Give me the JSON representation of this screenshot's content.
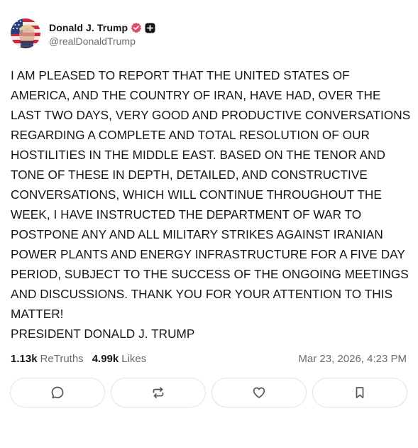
{
  "author": {
    "display_name": "Donald J. Trump",
    "handle": "@realDonaldTrump",
    "avatar_icon": "avatar-flag-portrait",
    "verified_color": "#e24b6a"
  },
  "post": {
    "text": "I AM PLEASED TO REPORT THAT THE UNITED STATES OF AMERICA, AND THE COUNTRY OF IRAN, HAVE HAD, OVER THE LAST TWO DAYS, VERY GOOD AND PRODUCTIVE CONVERSATIONS REGARDING A COMPLETE AND TOTAL RESOLUTION OF OUR HOSTILITIES IN THE MIDDLE EAST. BASED ON THE TENOR AND TONE OF THESE IN DEPTH, DETAILED, AND CONSTRUCTIVE CONVERSATIONS, WHICH WILL CONTINUE THROUGHOUT THE WEEK, I HAVE INSTRUCTED THE DEPARTMENT OF WAR TO POSTPONE ANY AND ALL MILITARY STRIKES AGAINST IRANIAN POWER PLANTS AND ENERGY INFRASTRUCTURE FOR A FIVE DAY PERIOD, SUBJECT TO THE SUCCESS OF THE ONGOING MEETINGS AND DISCUSSIONS. THANK YOU FOR YOUR ATTENTION TO THIS MATTER!\nPRESIDENT DONALD J. TRUMP"
  },
  "stats": {
    "retruths_count": "1.13k",
    "retruths_label": "ReTruths",
    "likes_count": "4.99k",
    "likes_label": "Likes",
    "timestamp": "Mar 23, 2026, 4:23 PM"
  },
  "actions": {
    "reply_icon": "reply-bubble-icon",
    "retruth_icon": "retruth-arrows-icon",
    "like_icon": "heart-icon",
    "bookmark_icon": "bookmark-icon"
  }
}
